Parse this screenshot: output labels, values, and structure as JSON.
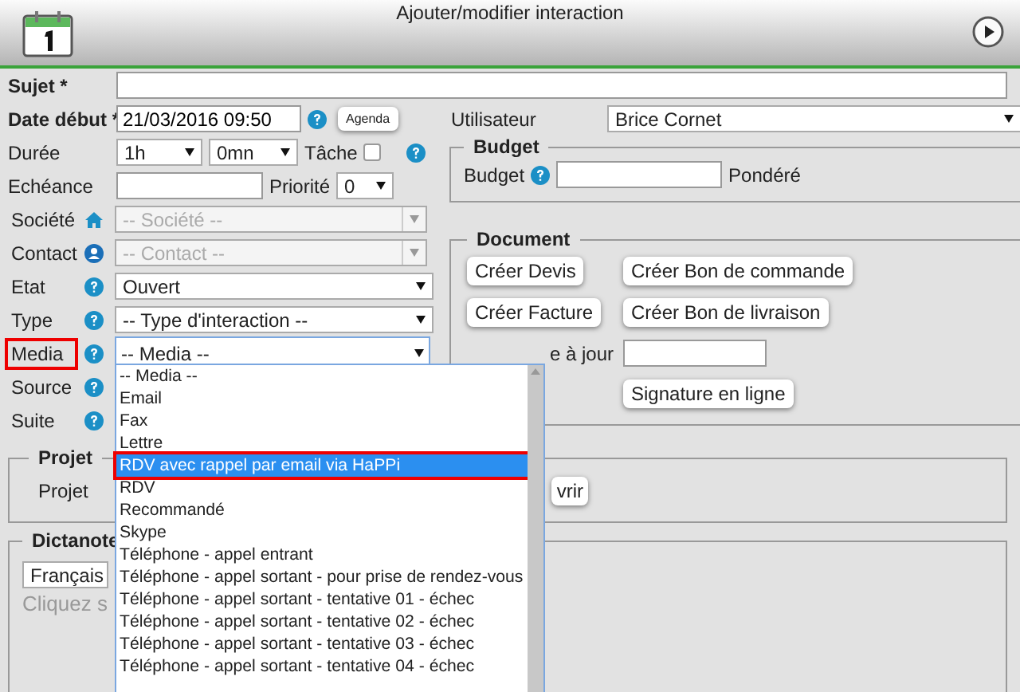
{
  "window": {
    "title": "Ajouter/modifier interaction"
  },
  "subject": {
    "label": "Sujet *",
    "required": true
  },
  "start": {
    "label": "Date début *",
    "required": true,
    "value": "21/03/2016 09:50",
    "button": "Agenda"
  },
  "duration": {
    "label": "Durée",
    "hours": "1h",
    "minutes": "0mn",
    "task_label": "Tâche",
    "task_checked": false
  },
  "due": {
    "label": "Echéance",
    "priority_label": "Priorité",
    "priority": "0"
  },
  "selects": [
    {
      "label": "Société",
      "value": "-- Société --",
      "disabled": true,
      "marked": false
    },
    {
      "label": "Contact",
      "value": "-- Contact --",
      "disabled": true,
      "marked": false
    },
    {
      "label": "Etat",
      "value": "Ouvert",
      "disabled": false,
      "marked": false
    },
    {
      "label": "Type",
      "value": "-- Type d'interaction --",
      "disabled": false,
      "marked": false
    },
    {
      "label": "Media",
      "value": "-- Media --",
      "disabled": false,
      "marked": true
    },
    {
      "label": "Source",
      "marked": false
    },
    {
      "label": "Suite",
      "marked": false
    }
  ],
  "media_list": {
    "open": true,
    "options": [
      {
        "label": "-- Media --",
        "selected": false,
        "marked": false
      },
      {
        "label": "Email",
        "selected": false,
        "marked": false
      },
      {
        "label": "Fax",
        "selected": false,
        "marked": false
      },
      {
        "label": "Lettre",
        "selected": false,
        "marked": false
      },
      {
        "label": "RDV avec rappel par email via HaPPi",
        "selected": true,
        "marked": true
      },
      {
        "label": "RDV",
        "selected": false,
        "marked": false
      },
      {
        "label": "Recommandé",
        "selected": false,
        "marked": false
      },
      {
        "label": "Skype",
        "selected": false,
        "marked": false
      },
      {
        "label": "Téléphone - appel entrant",
        "selected": false,
        "marked": false
      },
      {
        "label": "Téléphone - appel sortant - pour prise de rendez-vous",
        "selected": false,
        "marked": false
      },
      {
        "label": "Téléphone - appel sortant - tentative 01 - échec",
        "selected": false,
        "marked": false
      },
      {
        "label": "Téléphone - appel sortant - tentative 02 - échec",
        "selected": false,
        "marked": false
      },
      {
        "label": "Téléphone - appel sortant - tentative 03 - échec",
        "selected": false,
        "marked": false
      },
      {
        "label": "Téléphone - appel sortant - tentative 04 - échec",
        "selected": false,
        "marked": false
      }
    ]
  },
  "user": {
    "label": "Utilisateur",
    "value": "Brice Cornet"
  },
  "budget": {
    "legend": "Budget",
    "label": "Budget",
    "weighted_label": "Pondéré"
  },
  "document": {
    "legend": "Document",
    "buttons": [
      "Créer Devis",
      "Créer Bon de commande",
      "Créer Facture",
      "Créer Bon de livraison"
    ],
    "update_label": "e à jour",
    "sign_button": "Signature en ligne"
  },
  "project": {
    "legend": "Projet",
    "label": "Projet",
    "button": "vrir"
  },
  "dictanote": {
    "legend": "Dictanote",
    "language": "Français",
    "hint": "Cliquez s"
  }
}
